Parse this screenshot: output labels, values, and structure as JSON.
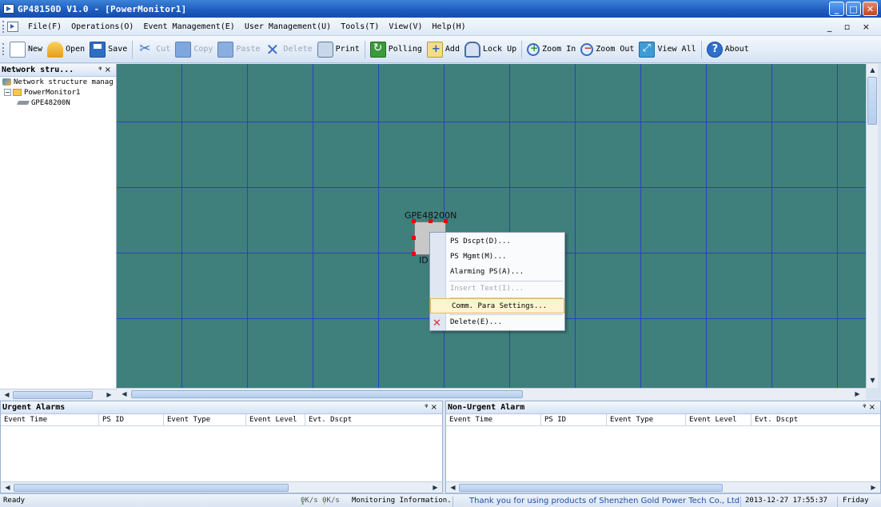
{
  "window": {
    "title": "GP48150D V1.0 - [PowerMonitor1]",
    "controls": [
      "_",
      "□",
      "✕"
    ]
  },
  "menubar": {
    "items": [
      {
        "label": "File(F)"
      },
      {
        "label": "Operations(O)"
      },
      {
        "label": "Event Management(E)"
      },
      {
        "label": "User Management(U)"
      },
      {
        "label": "Tools(T)"
      },
      {
        "label": "View(V)"
      },
      {
        "label": "Help(H)"
      }
    ],
    "mdi_controls": "_ ▫ ×"
  },
  "toolbar": {
    "buttons": [
      {
        "label": "New",
        "icon": "new-icon",
        "enabled": true
      },
      {
        "label": "Open",
        "icon": "open-icon",
        "enabled": true
      },
      {
        "label": "Save",
        "icon": "save-icon",
        "enabled": true
      },
      {
        "label": "Cut",
        "icon": "cut-icon",
        "enabled": false
      },
      {
        "label": "Copy",
        "icon": "copy-icon",
        "enabled": false
      },
      {
        "label": "Paste",
        "icon": "paste-icon",
        "enabled": false
      },
      {
        "label": "Delete",
        "icon": "delete-icon",
        "enabled": false
      },
      {
        "label": "Print",
        "icon": "print-icon",
        "enabled": true
      },
      {
        "label": "Polling",
        "icon": "polling-icon",
        "enabled": true
      },
      {
        "label": "Add",
        "icon": "add-icon",
        "enabled": true
      },
      {
        "label": "Lock Up",
        "icon": "lock-icon",
        "enabled": true
      },
      {
        "label": "Zoom In",
        "icon": "zoom-in-icon",
        "enabled": true
      },
      {
        "label": "Zoom Out",
        "icon": "zoom-out-icon",
        "enabled": true
      },
      {
        "label": "View All",
        "icon": "view-all-icon",
        "enabled": true
      },
      {
        "label": "About",
        "icon": "about-icon",
        "enabled": true
      }
    ]
  },
  "left_panel": {
    "title": "Network stru...",
    "pin": "ᵠ ×",
    "tree": {
      "root": "Network structure manag",
      "folder": "PowerMonitor1",
      "device": "GPE48200N"
    }
  },
  "canvas": {
    "background": "#3f7f7c",
    "grid_color": "#2a3cc8",
    "device": {
      "label": "GPE48200N",
      "id_label": "ID"
    }
  },
  "context_menu": {
    "items": [
      {
        "label": "PS Dscpt(D)...",
        "enabled": true
      },
      {
        "label": "PS Mgmt(M)...",
        "enabled": true
      },
      {
        "label": "Alarming PS(A)...",
        "enabled": true
      },
      {
        "label": "Insert Text(I)...",
        "enabled": false
      },
      {
        "label": "Comm. Para Settings...",
        "enabled": true,
        "highlighted": true
      },
      {
        "label": "Delete(E)...",
        "enabled": true
      }
    ]
  },
  "urgent_alarms": {
    "title": "Urgent Alarms",
    "pin": "ᵠ ×",
    "columns": [
      "Event Time",
      "PS ID",
      "Event Type",
      "Event Level",
      "Evt. Dscpt"
    ]
  },
  "non_urgent_alarms": {
    "title": "Non-Urgent Alarm",
    "pin": "ᵠ ×",
    "columns": [
      "Event Time",
      "PS ID",
      "Event Type",
      "Event Level",
      "Evt. Dscpt"
    ]
  },
  "statusbar": {
    "ready": "Ready",
    "down_speed": "0K/s",
    "up_speed": "0K/s",
    "message": "Monitoring Information.",
    "thanks": "Thank you for using products of Shenzhen Gold Power Tech Co., Ltd",
    "datetime": "2013-12-27 17:55:37",
    "day": "Friday"
  }
}
